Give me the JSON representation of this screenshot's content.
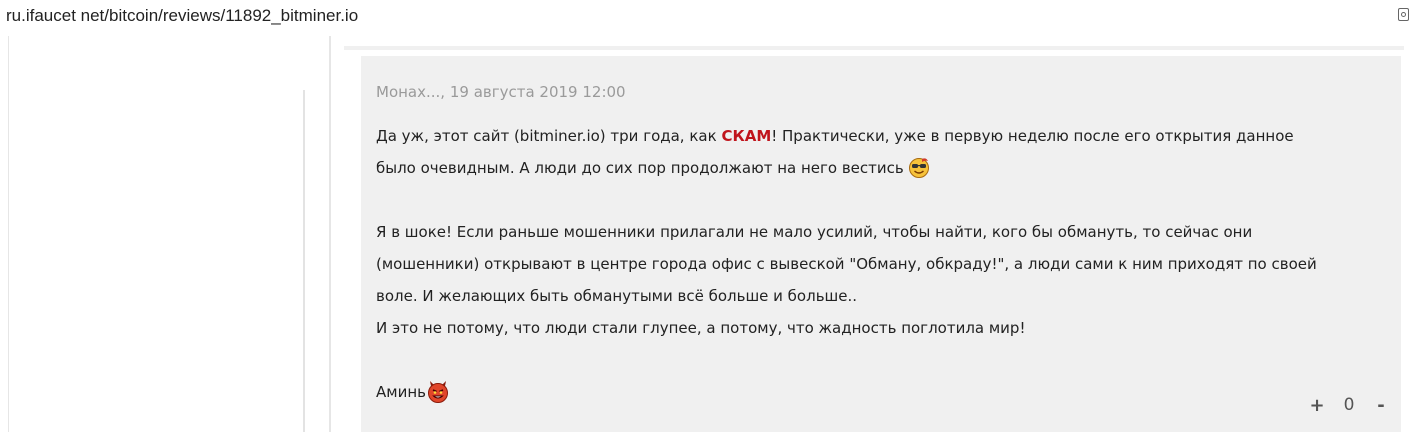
{
  "browser": {
    "url": "ru.ifaucet net/bitcoin/reviews/11892_bitminer.io"
  },
  "comment": {
    "author_date": "Монах..., 19 августа 2019 12:00",
    "p1_before": "Да уж, этот сайт (bitminer.io) три года, как ",
    "p1_scam": "СКАМ",
    "p1_after": "! Практически, уже в первую неделю после его открытия данное",
    "p2": "было очевидным. А люди до сих пор продолжают на него вестись",
    "p3": "Я в шоке! Если раньше мошенники прилагали не мало усилий, чтобы найти, кого бы обмануть, то сейчас они",
    "p4": "(мошенники) открывают в центре города офис с вывеской \"Обману, обкраду!\", а люди сами к ним приходят по своей",
    "p5": "воле. И желающих быть обманутыми всё больше и больше..",
    "p6": "И это не потому, что люди стали глупее, а потому, что жадность поглотила мир!",
    "p7": "Аминь",
    "emoji_1": "sunglasses-smiley-icon",
    "emoji_2": "devil-smiley-icon"
  },
  "votes": {
    "plus": "+",
    "count": "0",
    "minus": "-"
  },
  "colors": {
    "scam": "#c0141c",
    "comment_bg": "#f0f0f0",
    "meta": "#9a9a9a"
  }
}
